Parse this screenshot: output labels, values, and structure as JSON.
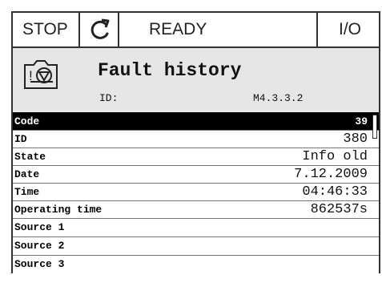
{
  "status_bar": {
    "state": "STOP",
    "mode": "READY",
    "control": "I/O"
  },
  "header": {
    "title": "Fault history",
    "id_label": "ID:",
    "id_value": "M4.3.3.2"
  },
  "rows": [
    {
      "label": "Code",
      "value": "39"
    },
    {
      "label": "ID",
      "value": "380"
    },
    {
      "label": "State",
      "value": "Info old"
    },
    {
      "label": "Date",
      "value": "7.12.2009"
    },
    {
      "label": "Time",
      "value": "04:46:33"
    },
    {
      "label": "Operating time",
      "value": "862537s"
    },
    {
      "label": "Source 1",
      "value": ""
    },
    {
      "label": "Source 2",
      "value": ""
    },
    {
      "label": "Source 3",
      "value": ""
    }
  ],
  "icons": {
    "direction": "rotation-arrow-icon",
    "menu": "fault-history-icon"
  }
}
